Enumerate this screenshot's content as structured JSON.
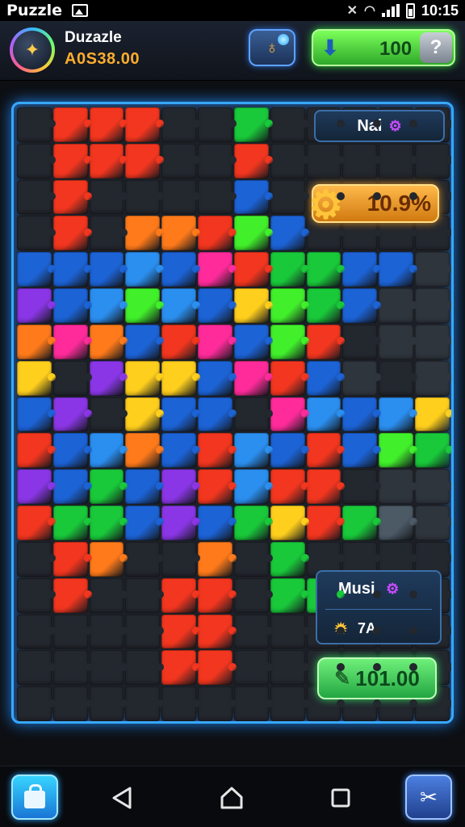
{
  "status_bar": {
    "app_name": "Puzzle",
    "time": "10:15",
    "icons": [
      "image-icon",
      "nfc-icon",
      "wifi-icon",
      "signal-icon",
      "battery-icon"
    ]
  },
  "header": {
    "player_name": "Duzazle",
    "player_score": "A0S38.00",
    "coin_balance": "100",
    "help_label": "?",
    "colors": {
      "accent": "#37a8ff",
      "coins": "#3ed43a",
      "score": "#ffad2e"
    }
  },
  "side_panel": {
    "mai_label": "Nai",
    "progress_percent": "10.9%",
    "musi_label": "Musi",
    "musi_count": "7A",
    "cash_label": "101.00"
  },
  "board": {
    "columns": 12,
    "rows": 17,
    "palette": {
      "R": "#f2361f",
      "O": "#ff7a1a",
      "Y": "#ffcf1d",
      "G": "#19c93a",
      "L": "#41f02b",
      "B": "#1c63d6",
      "b": "#2b8ff0",
      "P": "#8a36e6",
      "M": "#ff2b9a",
      "D": "#23272e",
      "d": "#2f353d",
      "g": "#4c5a66"
    },
    "layout": [
      "DRRRDDGDDDDD",
      "DRRRDDRDDDDD",
      "DRDDDDBDDDDD",
      "DRDOORLBDDDD",
      "BBBbBMRGGBBd",
      "PBbLbBYLGBdd",
      "OMOBRMBLRDdd",
      "YDPYYBMRBdDd",
      "BPDYBBDMbBbY",
      "RBbOBRbBRBLG",
      "PBGBPRbRRDdd",
      "RGGBPBGYRGgd",
      "DRODDODGDDDD",
      "DRDDRRDGGDDD",
      "DDDDRRDDDDDD",
      "DDDDRRDDDDDD",
      "DDDDDDDDDDDD"
    ]
  },
  "nav": {
    "shop_icon": "shopping-bag-icon",
    "tools_icon": "tools-icon",
    "system": [
      "back-icon",
      "home-icon",
      "recent-apps-icon"
    ]
  }
}
